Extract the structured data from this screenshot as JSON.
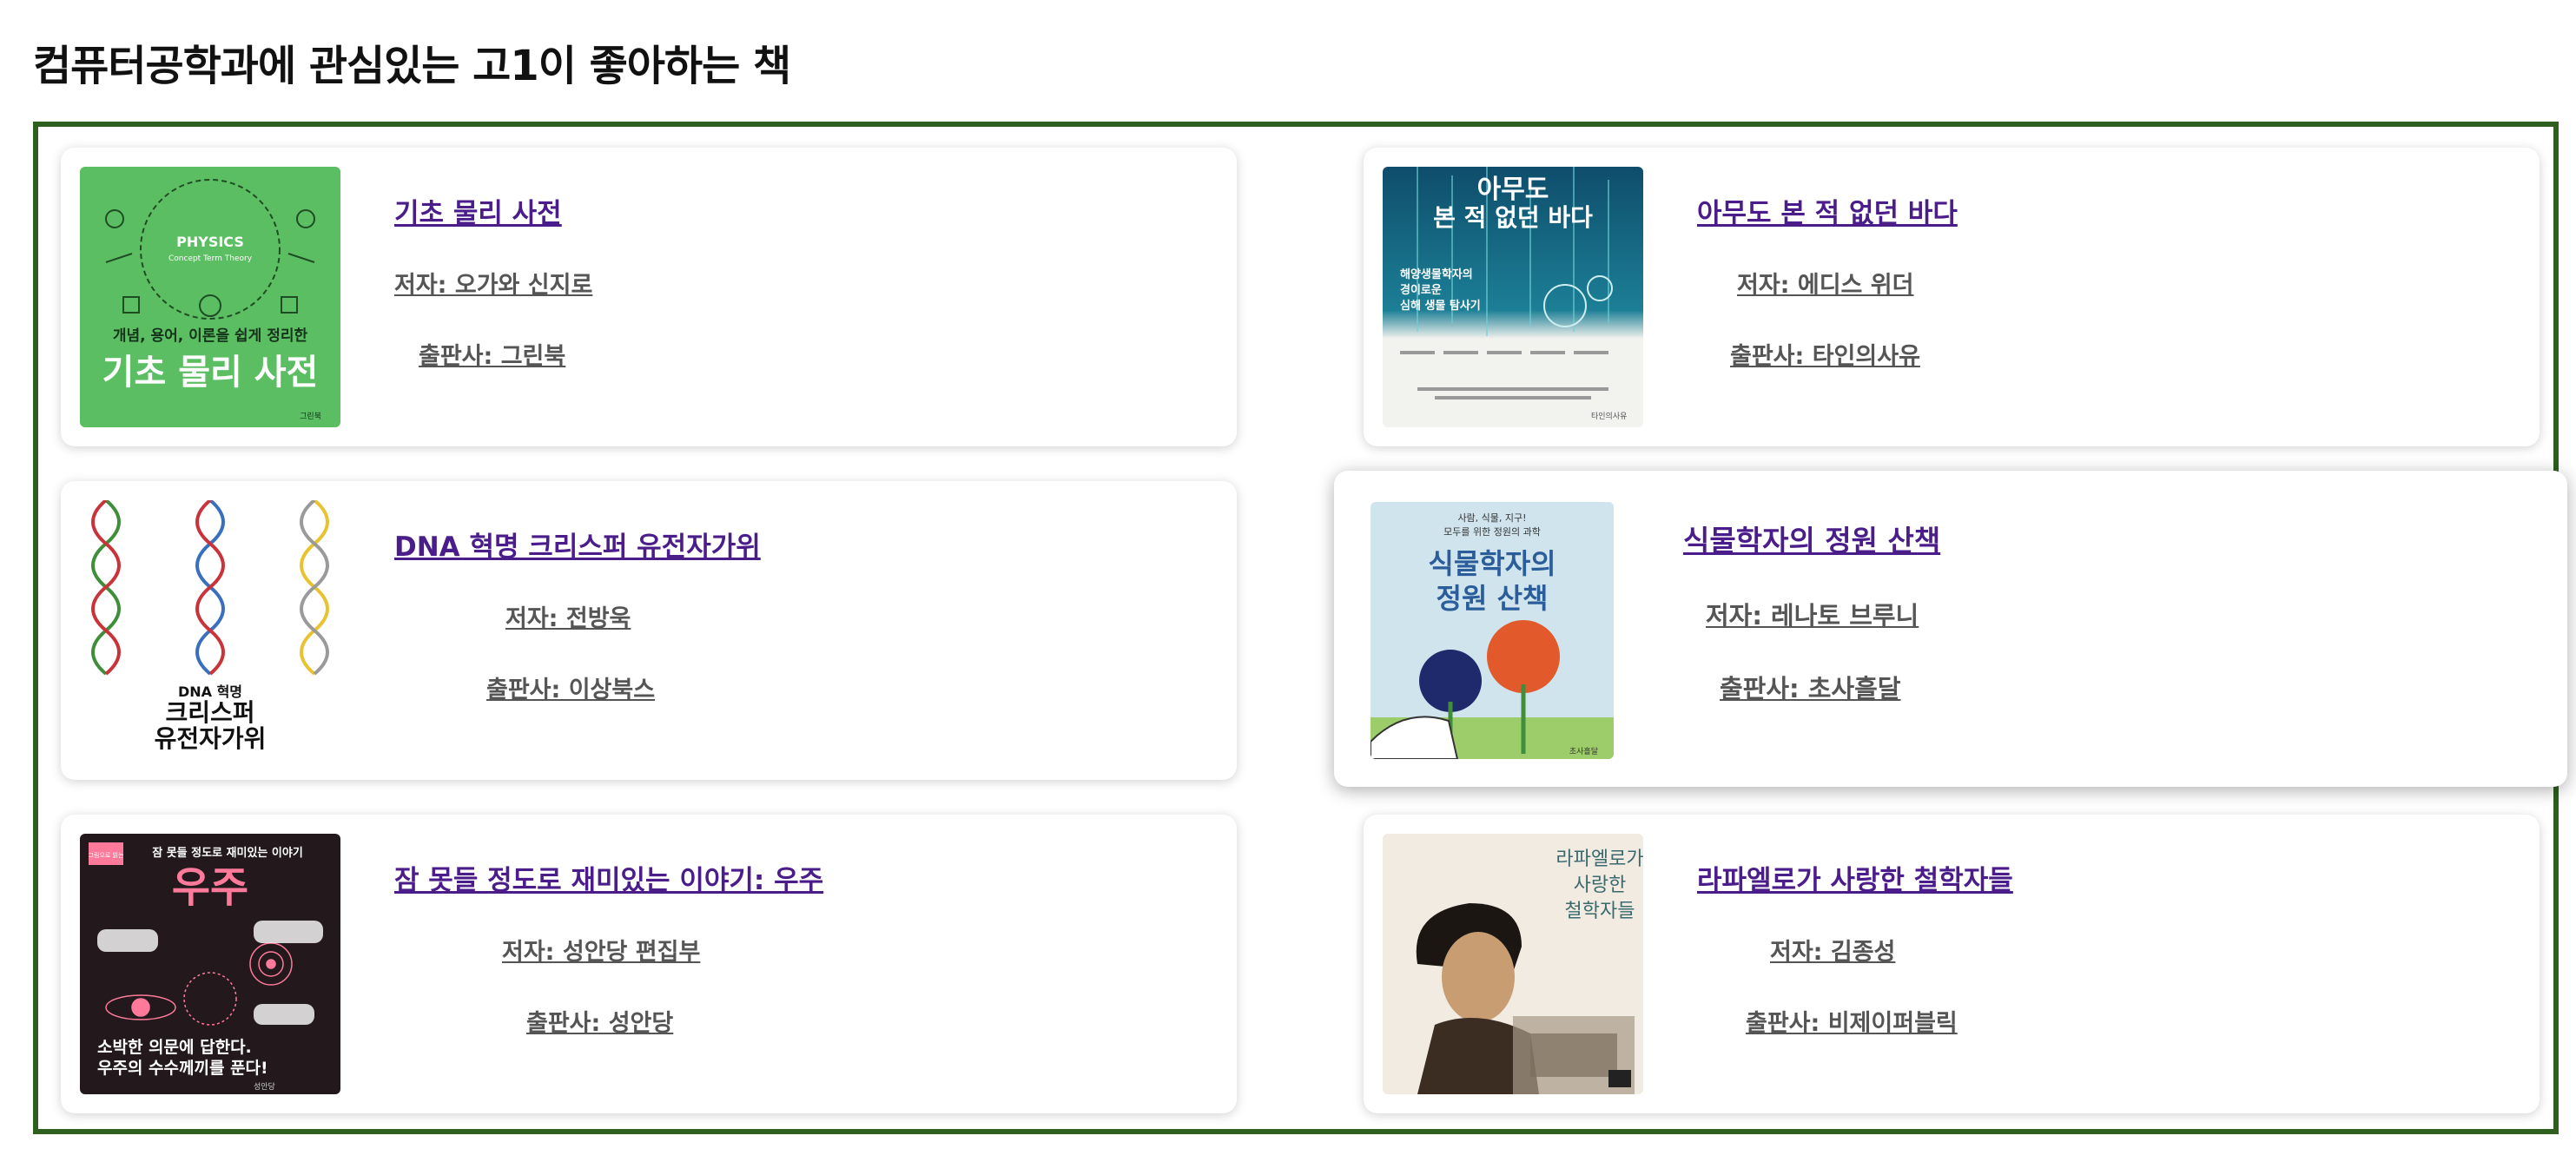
{
  "page": {
    "title": "컴퓨터공학과에 관심있는 고1이 좋아하는 책"
  },
  "books": [
    {
      "title": "기초 물리 사전",
      "author": "저자: 오가와 신지로",
      "publisher": "출판사: 그린북",
      "cover": {
        "top": "PHYSICS",
        "sub": "Concept Term Theory",
        "tagline": "개념, 용어, 이론을 쉽게 정리한",
        "big": "기초 물리 사전",
        "imprint": "그린북"
      }
    },
    {
      "title": "아무도 본 적 없던 바다",
      "author": "저자: 에디스 위더",
      "publisher": "출판사: 타인의사유",
      "cover": {
        "big1": "아무도",
        "big2": "본 적 없던 바다",
        "sub1": "해양생물학자의",
        "sub2": "경이로운",
        "sub3": "심해 생물 탐사기",
        "imprint": "타인의사유"
      }
    },
    {
      "title": "DNA 혁명 크리스퍼 유전자가위",
      "author": "저자: 전방욱",
      "publisher": "출판사: 이상북스",
      "cover": {
        "small": "DNA 혁명",
        "big1": "크리스퍼",
        "big2": "유전자가위"
      }
    },
    {
      "title": "식물학자의 정원 산책",
      "author": "저자: 레나토 브루니",
      "publisher": "출판사: 초사흘달",
      "cover": {
        "sub1": "사람, 식물, 지구!",
        "sub2": "모두를 위한 정원의 과학",
        "big1": "식물학자의",
        "big2": "정원 산책",
        "imprint": "초사흘달"
      }
    },
    {
      "title": "잠 못들 정도로 재미있는 이야기: 우주",
      "author": "저자: 성안당 편집부",
      "publisher": "출판사: 성안당",
      "cover": {
        "badge": "그림으로 읽는",
        "top": "잠 못들 정도로 재미있는 이야기",
        "big": "우주",
        "line1": "소박한 의문에 답한다.",
        "line2": "우주의 수수께끼를 푼다!",
        "imprint": "성안당"
      }
    },
    {
      "title": "라파엘로가 사랑한 철학자들",
      "author": "저자: 김종성",
      "publisher": "출판사: 비제이퍼블릭",
      "cover": {
        "t1": "라파엘로가",
        "t2": "사랑한",
        "t3": "철학자들"
      }
    }
  ],
  "colors": {
    "frame": "#2e5f1e",
    "link": "#4a1d8a",
    "physics_bg": "#5cbe62",
    "space_bg": "#23191d",
    "space_accent": "#ff7a9a"
  }
}
